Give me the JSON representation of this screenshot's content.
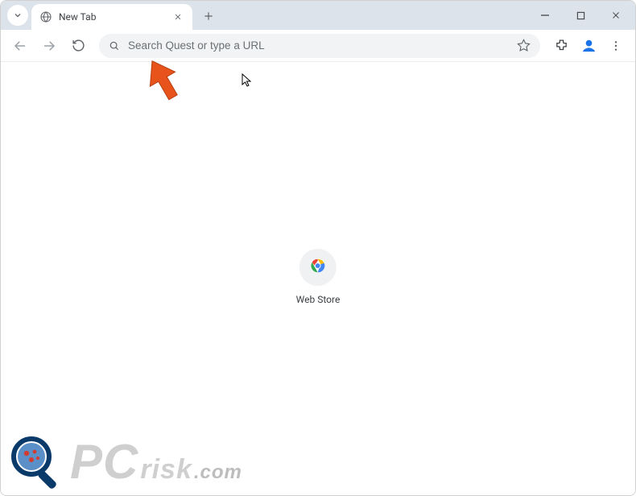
{
  "tab": {
    "title": "New Tab"
  },
  "omnibox": {
    "placeholder": "Search Quest or type a URL",
    "value": ""
  },
  "shortcut": {
    "label": "Web Store"
  },
  "watermark": {
    "pc": "PC",
    "risk": "risk",
    "com": ".com"
  }
}
